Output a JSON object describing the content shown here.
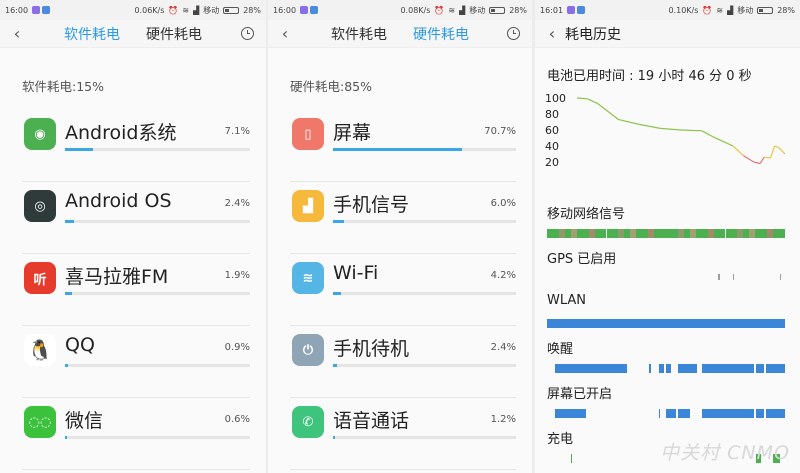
{
  "status_left": {
    "time": "16:00",
    "speed": "0.06K/s",
    "carrier": "移动",
    "battery": "28%"
  },
  "status_mid": {
    "time": "16:00",
    "speed": "0.08K/s",
    "carrier": "移动",
    "battery": "28%"
  },
  "status_right": {
    "time": "16:01",
    "speed": "0.10K/s",
    "carrier": "移动",
    "battery": "28%"
  },
  "tabs": {
    "software": "软件耗电",
    "hardware": "硬件耗电"
  },
  "software": {
    "summary": "软件耗电:15%",
    "items": [
      {
        "name": "Android系统",
        "percent": "7.1%",
        "fraction": 0.071,
        "icon": "android-icon",
        "color": "#4caf50"
      },
      {
        "name": "Android OS",
        "percent": "2.4%",
        "fraction": 0.024,
        "icon": "android-os-icon",
        "color": "#2f3a3a"
      },
      {
        "name": "喜马拉雅FM",
        "percent": "1.9%",
        "fraction": 0.019,
        "icon": "ximalaya-icon",
        "color": "#e53b2c"
      },
      {
        "name": "QQ",
        "percent": "0.9%",
        "fraction": 0.009,
        "icon": "qq-penguin-icon",
        "color": "#ffffff"
      },
      {
        "name": "微信",
        "percent": "0.6%",
        "fraction": 0.006,
        "icon": "wechat-icon",
        "color": "#3bc13b"
      }
    ]
  },
  "hardware": {
    "summary": "硬件耗电:85%",
    "items": [
      {
        "name": "屏幕",
        "percent": "70.7%",
        "fraction": 0.707,
        "icon": "screen-icon",
        "color": "#f0786a"
      },
      {
        "name": "手机信号",
        "percent": "6.0%",
        "fraction": 0.06,
        "icon": "signal-icon",
        "color": "#f6b93b"
      },
      {
        "name": "Wi-Fi",
        "percent": "4.2%",
        "fraction": 0.042,
        "icon": "wifi-icon",
        "color": "#55b5e5"
      },
      {
        "name": "手机待机",
        "percent": "2.4%",
        "fraction": 0.024,
        "icon": "power-icon",
        "color": "#8fa5b5"
      },
      {
        "name": "语音通话",
        "percent": "1.2%",
        "fraction": 0.012,
        "icon": "phone-icon",
        "color": "#3ec47c"
      }
    ]
  },
  "history": {
    "title": "耗电历史",
    "uptime": "电池已用时间 : 19 小时 46 分 0 秒",
    "tracks": [
      {
        "label": "移动网络信号",
        "type": "signal"
      },
      {
        "label": "GPS 已启用",
        "type": "gps"
      },
      {
        "label": "WLAN",
        "type": "full"
      },
      {
        "label": "唤醒",
        "type": "wake"
      },
      {
        "label": "屏幕已开启",
        "type": "screen"
      },
      {
        "label": "充电",
        "type": "charge"
      }
    ]
  },
  "chart_data": {
    "type": "line",
    "title": "",
    "xlabel": "",
    "ylabel": "",
    "ylim": [
      0,
      100
    ],
    "yticks": [
      "100",
      "80",
      "60",
      "40",
      "20"
    ],
    "x": [
      0,
      0.05,
      0.1,
      0.2,
      0.3,
      0.4,
      0.5,
      0.6,
      0.65,
      0.7,
      0.75,
      0.8,
      0.85,
      0.88,
      0.9,
      0.93,
      0.95,
      0.97,
      1.0
    ],
    "series": [
      {
        "values": [
          100,
          99,
          93,
          73,
          67,
          62,
          60,
          59,
          52,
          46,
          40,
          28,
          20,
          18,
          26,
          25,
          40,
          38,
          30
        ]
      }
    ],
    "colors": {
      "high": "#8bc34a",
      "mid": "#e6c84a",
      "low": "#e57373"
    }
  },
  "watermark": "中关村 CNMO"
}
